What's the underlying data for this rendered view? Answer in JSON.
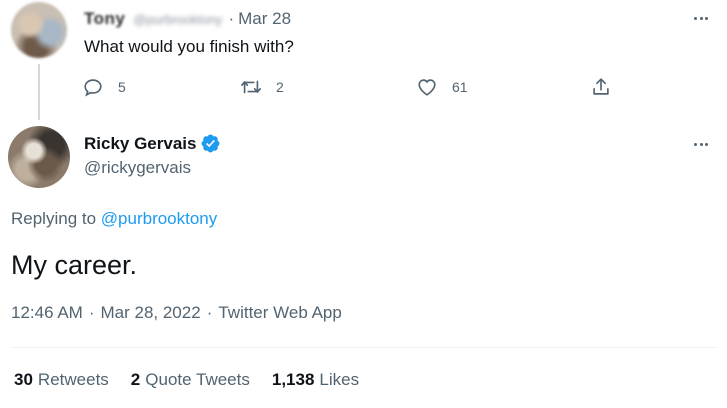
{
  "parent_tweet": {
    "name": "Tony",
    "handle": "@purbrooktony",
    "dot": "·",
    "date": "Mar 28",
    "text": "What would you finish with?",
    "actions": {
      "reply_icon": "reply-icon",
      "reply_count": "5",
      "retweet_icon": "retweet-icon",
      "retweet_count": "2",
      "like_icon": "heart-icon",
      "like_count": "61",
      "share_icon": "share-icon"
    }
  },
  "main_tweet": {
    "name": "Ricky Gervais",
    "verified_icon": "verified-badge-icon",
    "handle": "@rickygervais",
    "replying_prefix": "Replying to ",
    "replying_to": "@purbrooktony",
    "text": "My career.",
    "time": "12:46 AM",
    "date": "Mar 28, 2022",
    "source": "Twitter Web App",
    "sep": "·",
    "stats": {
      "retweets_num": "30",
      "retweets_label": "Retweets",
      "quotes_num": "2",
      "quotes_label": "Quote Tweets",
      "likes_num": "1,138",
      "likes_label": "Likes"
    }
  },
  "colors": {
    "link": "#1d9bf0",
    "secondary_text": "#536471",
    "primary_text": "#0f1419",
    "verified": "#1d9bf0"
  }
}
